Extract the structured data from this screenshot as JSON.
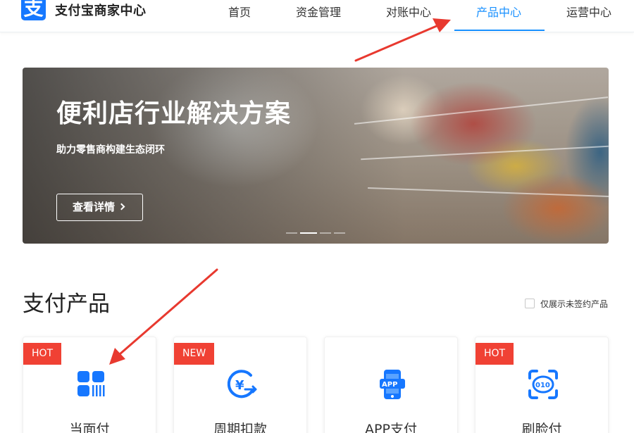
{
  "header": {
    "brand": "支付宝商家中心",
    "logo_glyph": "支",
    "nav": [
      {
        "label": "首页"
      },
      {
        "label": "资金管理"
      },
      {
        "label": "对账中心"
      },
      {
        "label": "产品中心"
      },
      {
        "label": "运营中心"
      }
    ],
    "active_nav": "产品中心",
    "accent_color": "#1890ff"
  },
  "banner": {
    "title": "便利店行业解决方案",
    "subtitle": "助力零售商构建生态闭环",
    "button_label": "查看详情",
    "slides_total": 4,
    "active_slide": 2
  },
  "section": {
    "title": "支付产品",
    "filter_label": "仅展示未签约产品",
    "filter_checked": false
  },
  "products": [
    {
      "tag": "HOT",
      "label": "当面付",
      "icon": "barcode-grid-icon"
    },
    {
      "tag": "NEW",
      "label": "周期扣款",
      "icon": "cycle-yuan-icon"
    },
    {
      "tag": "",
      "label": "APP支付",
      "icon": "mobile-app-icon"
    },
    {
      "tag": "HOT",
      "label": "刷脸付",
      "icon": "face-scan-icon"
    }
  ],
  "colors": {
    "tag_red": "#f04134",
    "icon_blue": "#1677ff",
    "annotation_red": "#e8392f"
  }
}
